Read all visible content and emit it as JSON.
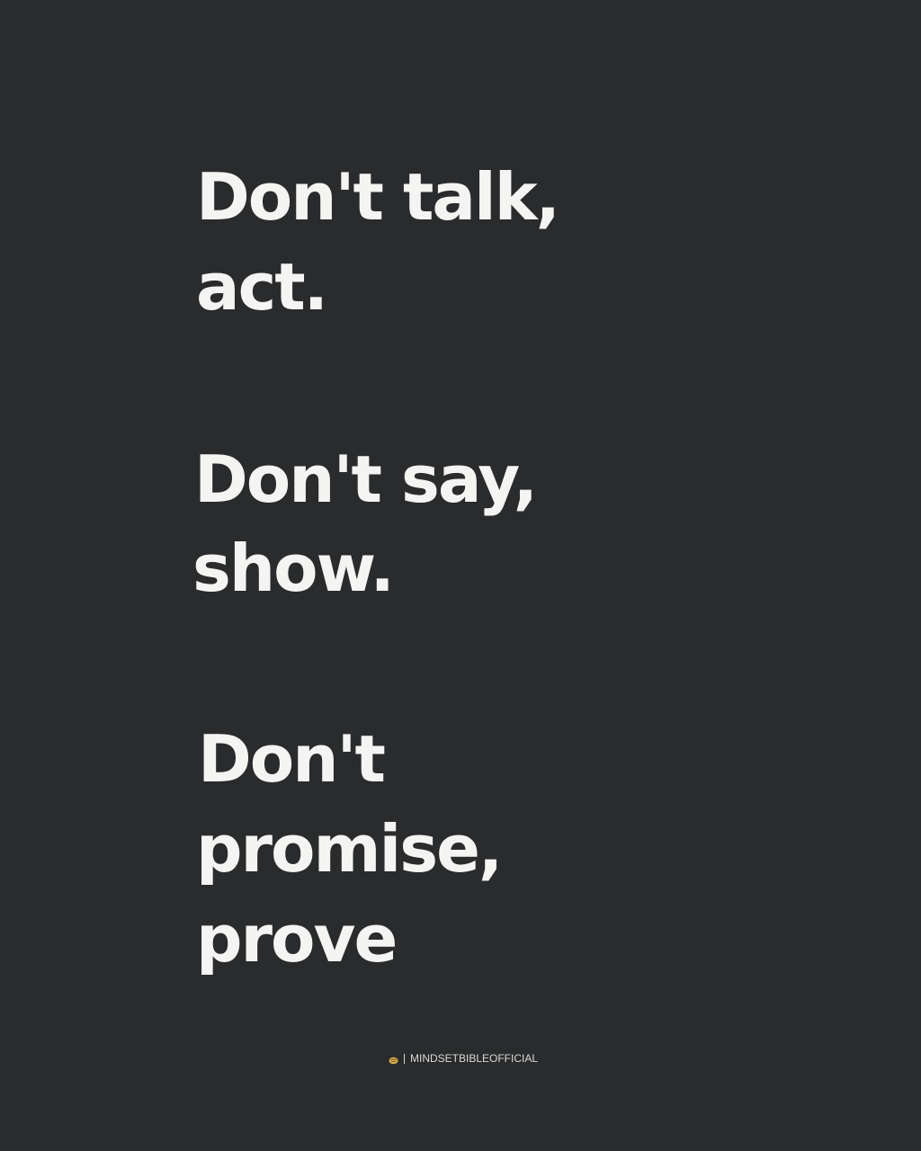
{
  "quote": {
    "lines": [
      "Don't talk,",
      "act.",
      "Don't say,",
      "show.",
      "Don't",
      "promise,",
      "prove"
    ]
  },
  "credit": {
    "icon": "brain-logo-icon",
    "handle": "MINDSETBIBLEOFFICIAL"
  },
  "colors": {
    "background": "#2a2b2d",
    "text": "#f4f4f2",
    "icon_accent": "#e0b14a"
  }
}
